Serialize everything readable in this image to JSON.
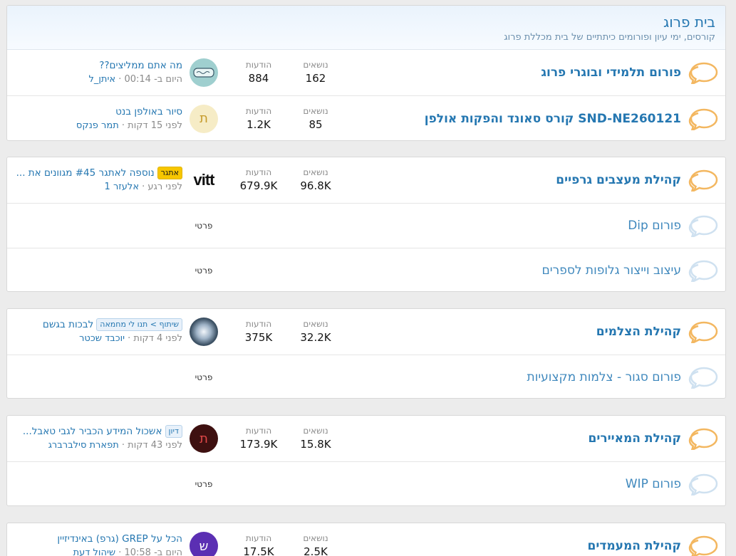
{
  "category1": {
    "title": "בית פרוג",
    "description": "קורסים, ימי עיון ופורומים כיתתיים של בית מכללת פרוג",
    "nodes": [
      {
        "title": "פורום תלמידי ובוגרי פרוג",
        "topics_label": "נושאים",
        "topics": "162",
        "posts_label": "הודעות",
        "posts": "884",
        "last_title": "מה אתם ממליצים??",
        "last_meta": "היום ב- 00:14 · ",
        "last_user": "איתן_ל"
      },
      {
        "title": "SND-NE260121 קורס סאונד והפקות אולפן",
        "topics_label": "נושאים",
        "topics": "85",
        "posts_label": "הודעות",
        "posts": "1.2K",
        "avatar_letter": "ת",
        "last_title": "סיור באולפן בנט",
        "last_meta": "לפני 15 דקות · ",
        "last_user": "תמר פנקס"
      }
    ]
  },
  "category2": {
    "nodes": [
      {
        "title": "קהילת מעצבים גרפיים",
        "topics_label": "נושאים",
        "topics": "96.8K",
        "posts_label": "הודעות",
        "posts": "679.9K",
        "avatar_text": "vitt",
        "prefix": "אתגר",
        "last_title": "נוספה לאתגר #45 מגוונים את ...",
        "last_meta": "לפני רגע · ",
        "last_user": "אלעזר 1"
      },
      {
        "title": "פורום Dip",
        "private_label": "פרטי"
      },
      {
        "title": "עיצוב וייצור גלופות לספרים",
        "private_label": "פרטי"
      }
    ]
  },
  "category3": {
    "nodes": [
      {
        "title": "קהילת הצלמים",
        "topics_label": "נושאים",
        "topics": "32.2K",
        "posts_label": "הודעות",
        "posts": "375K",
        "prefix": "שיתוף > תנו לי מחמאה",
        "last_title": "לבכות בגשם",
        "last_meta": "לפני 4 דקות · ",
        "last_user": "יוכבד שכטר"
      },
      {
        "title": "פורום סגור - צלמות מקצועיות",
        "private_label": "פרטי"
      }
    ]
  },
  "category4": {
    "nodes": [
      {
        "title": "קהילת המאיירים",
        "topics_label": "נושאים",
        "topics": "15.8K",
        "posts_label": "הודעות",
        "posts": "173.9K",
        "avatar_letter": "ת",
        "prefix": "דיון",
        "last_title": "אשכול המידע הכביר לגבי טאבל...",
        "last_meta": "לפני 43 דקות · ",
        "last_user": "תפארת סילברברג"
      },
      {
        "title": "פורום WIP",
        "private_label": "פרטי"
      }
    ]
  },
  "category5": {
    "nodes": [
      {
        "title": "קהילת המעמדים",
        "topics_label": "נושאים",
        "topics": "2.5K",
        "posts_label": "הודעות",
        "posts": "17.5K",
        "avatar_letter": "ש",
        "last_title": "הכל על GREP (גרפ) באינדיזיין",
        "last_meta": "היום ב- 10:58 · ",
        "last_user": "שיהול דעת"
      }
    ]
  },
  "colors": {
    "accent": "#2577b1",
    "icon_unread": "#f3b760",
    "icon_read": "#cfe1f0"
  }
}
